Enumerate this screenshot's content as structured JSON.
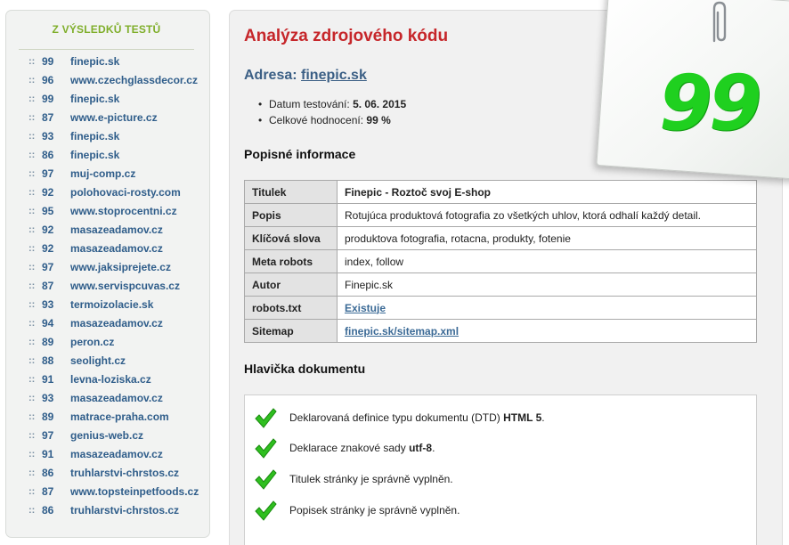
{
  "sidebar": {
    "title": "Z VÝSLEDKŮ TESTŮ",
    "results": [
      {
        "bullet": "::",
        "score": "99",
        "site": "finepic.sk"
      },
      {
        "bullet": "::",
        "score": "96",
        "site": "www.czechglassdecor.cz"
      },
      {
        "bullet": "::",
        "score": "99",
        "site": "finepic.sk"
      },
      {
        "bullet": "::",
        "score": "87",
        "site": "www.e-picture.cz"
      },
      {
        "bullet": "::",
        "score": "93",
        "site": "finepic.sk"
      },
      {
        "bullet": "::",
        "score": "86",
        "site": "finepic.sk"
      },
      {
        "bullet": "::",
        "score": "97",
        "site": "muj-comp.cz"
      },
      {
        "bullet": "::",
        "score": "92",
        "site": "polohovaci-rosty.com"
      },
      {
        "bullet": "::",
        "score": "95",
        "site": "www.stoprocentni.cz"
      },
      {
        "bullet": "::",
        "score": "92",
        "site": "masazeadamov.cz"
      },
      {
        "bullet": "::",
        "score": "92",
        "site": "masazeadamov.cz"
      },
      {
        "bullet": "::",
        "score": "97",
        "site": "www.jaksiprejete.cz"
      },
      {
        "bullet": "::",
        "score": "87",
        "site": "www.servispcuvas.cz"
      },
      {
        "bullet": "::",
        "score": "93",
        "site": "termoizolacie.sk"
      },
      {
        "bullet": "::",
        "score": "94",
        "site": "masazeadamov.cz"
      },
      {
        "bullet": "::",
        "score": "89",
        "site": "peron.cz"
      },
      {
        "bullet": "::",
        "score": "88",
        "site": "seolight.cz"
      },
      {
        "bullet": "::",
        "score": "91",
        "site": "levna-loziska.cz"
      },
      {
        "bullet": "::",
        "score": "93",
        "site": "masazeadamov.cz"
      },
      {
        "bullet": "::",
        "score": "89",
        "site": "matrace-praha.com"
      },
      {
        "bullet": "::",
        "score": "97",
        "site": "genius-web.cz"
      },
      {
        "bullet": "::",
        "score": "91",
        "site": "masazeadamov.cz"
      },
      {
        "bullet": "::",
        "score": "86",
        "site": "truhlarstvi-chrstos.cz"
      },
      {
        "bullet": "::",
        "score": "87",
        "site": "www.topsteinpetfoods.cz"
      },
      {
        "bullet": "::",
        "score": "86",
        "site": "truhlarstvi-chrstos.cz"
      }
    ]
  },
  "main": {
    "title": "Analýza zdrojového kódu",
    "address_label": "Adresa:",
    "address_link": "finepic.sk",
    "meta": {
      "date_label": "Datum testování:",
      "date_value": "5. 06. 2015",
      "rating_label": "Celkové hodnocení:",
      "rating_value": "99 %"
    },
    "descriptive_heading": "Popisné informace",
    "info_rows": {
      "title_label": "Titulek",
      "title_value": "Finepic - Roztoč svoj E-shop",
      "desc_label": "Popis",
      "desc_value": "Rotujúca produktová fotografia zo všetkých uhlov, ktorá odhalí každý detail.",
      "keywords_label": "Klíčová slova",
      "keywords_value": "produktova fotografia, rotacna, produkty, fotenie",
      "robots_label": "Meta robots",
      "robots_value": "index, follow",
      "author_label": "Autor",
      "author_value": "Finepic.sk",
      "robotstxt_label": "robots.txt",
      "robotstxt_value": "Existuje",
      "sitemap_label": "Sitemap",
      "sitemap_value": "finepic.sk/sitemap.xml"
    },
    "header_heading": "Hlavička dokumentu",
    "checks": {
      "c1_text": "Deklarovaná definice typu dokumentu (DTD)",
      "c1_bold": "HTML 5",
      "c1_end": ".",
      "c2_text": "Deklarace znakové sady",
      "c2_bold": "utf-8",
      "c2_end": ".",
      "c3_text": "Titulek stránky je správně vyplněn.",
      "c4_text": "Popisek stránky je správně vyplněn."
    }
  },
  "score_card": {
    "score": "99",
    "score_color": "#1fd01f"
  },
  "colors": {
    "accent_red": "#c6262a",
    "link_blue": "#2f5d8a",
    "sidebar_title_green": "#7fae2a",
    "check_green": "#2fbf1f"
  },
  "icons": {
    "bullet": "double-dot",
    "check": "green-checkmark-icon",
    "clip": "paperclip-icon"
  }
}
